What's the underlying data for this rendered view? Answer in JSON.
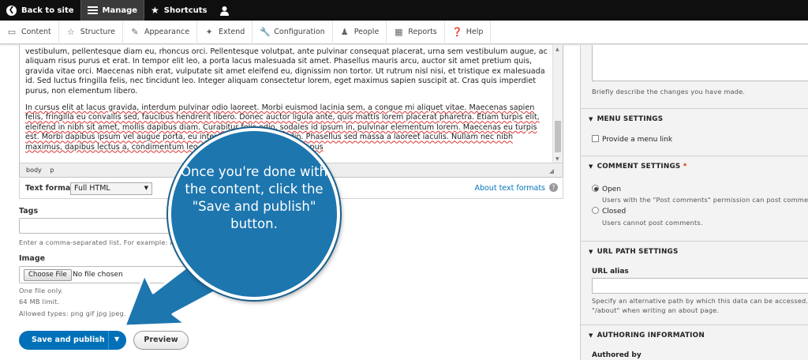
{
  "topbar": {
    "back": "Back to site",
    "manage": "Manage",
    "shortcuts": "Shortcuts"
  },
  "toolbar": {
    "items": [
      "Content",
      "Structure",
      "Appearance",
      "Extend",
      "Configuration",
      "People",
      "Reports",
      "Help"
    ]
  },
  "editor": {
    "p1": "vestibulum, pellentesque diam eu, rhoncus orci. Pellentesque volutpat, ante pulvinar consequat placerat, urna sem vestibulum augue, ac aliquam risus purus et erat. In tempor elit leo, a porta lacus malesuada sit amet. Phasellus mauris arcu, auctor sit amet pretium quis, gravida vitae orci. Maecenas nibh erat, vulputate sit amet eleifend eu, dignissim non tortor. Ut rutrum nisl nisi, et tristique ex malesuada id. Sed luctus fringilla felis, nec tincidunt leo. Integer aliquam consectetur lorem, eget maximus sapien suscipit at. Cras quis imperdiet purus, non elementum libero.",
    "p2": "In cursus elit at lacus gravida, interdum pulvinar odio laoreet. Morbi euismod lacinia sem, a congue mi aliquet vitae. Maecenas sapien felis, fringilla eu convallis sed, faucibus hendrerit libero. Donec auctor ligula ante, quis mattis lorem placerat pharetra. Etiam turpis elit, eleifend in nibh sit amet, mollis dapibus diam. Curabitur felis odio, sodales id ipsum in, pulvinar elementum lorem. Maecenas eu turpis est. Morbi dapibus ipsum vel augue porta, eu interdum quam sollicitudin. Phasellus sed massa a laoreet iaculis. Nullam nec nibh maximus, dapibus lectus a, condimentum leo. Sed consectetur arcu in tempus",
    "path1": "body",
    "path2": "p"
  },
  "text_format": {
    "label": "Text format",
    "selected": "Full HTML",
    "about": "About text formats"
  },
  "tags": {
    "label": "Tags",
    "help": "Enter a comma-separated list. For example: A"
  },
  "image": {
    "label": "Image",
    "choose": "Choose File",
    "nofile": "No file chosen",
    "help1": "One file only.",
    "help2": "64 MB limit.",
    "help3": "Allowed types: png gif jpg jpeg."
  },
  "actions": {
    "save": "Save and publish",
    "preview": "Preview"
  },
  "sidebar": {
    "revision_help": "Briefly describe the changes you have made.",
    "menu_head": "MENU SETTINGS",
    "menu_link": "Provide a menu link",
    "comment_head": "COMMENT SETTINGS",
    "open": "Open",
    "open_help": "Users with the \"Post comments\" permission can post comme",
    "closed": "Closed",
    "closed_help": "Users cannot post comments.",
    "url_head": "URL PATH SETTINGS",
    "url_alias": "URL alias",
    "url_help1": "Specify an alternative path by which this data can be accessed. F",
    "url_help2": "\"/about\" when writing an about page.",
    "auth_head": "AUTHORING INFORMATION",
    "authored_by": "Authored by"
  },
  "callout": {
    "text": "Once you're done with the content, click the \"Save and publish\" button."
  },
  "colors": {
    "accent": "#0071b8",
    "callout": "#1d76ae"
  }
}
